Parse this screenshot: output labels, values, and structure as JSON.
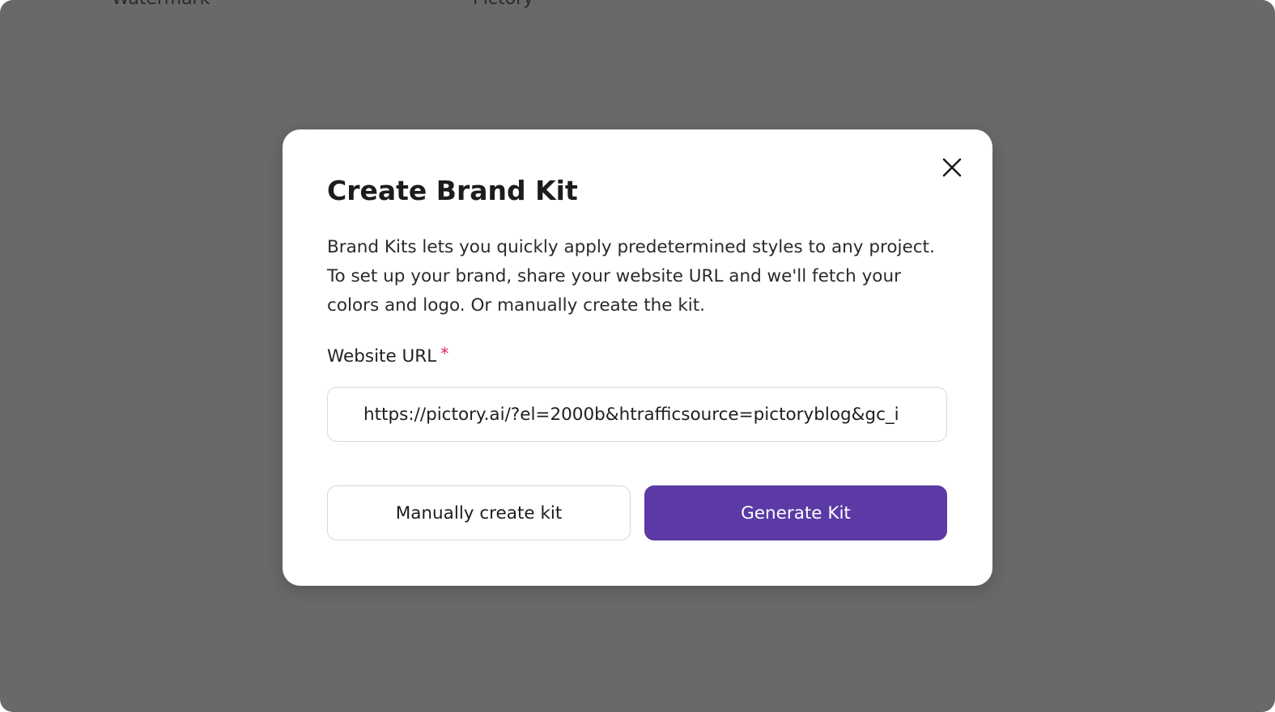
{
  "background": {
    "labels": [
      "Watermark",
      "Pictory"
    ]
  },
  "modal": {
    "title": "Create Brand Kit",
    "description": "Brand Kits lets you quickly apply predetermined styles to any project. To set up your brand, share your website URL and we'll fetch your colors and logo. Or manually create the kit.",
    "url_label": "Website URL",
    "required_mark": "*",
    "url_value": "https://pictory.ai/?el=2000b&htrafficsource=pictoryblog&gc_i",
    "manual_button": "Manually create kit",
    "generate_button": "Generate Kit",
    "close_icon": "close-icon"
  },
  "colors": {
    "overlay": "#696969",
    "primary": "#5b3aa6",
    "required": "#e0245e"
  }
}
